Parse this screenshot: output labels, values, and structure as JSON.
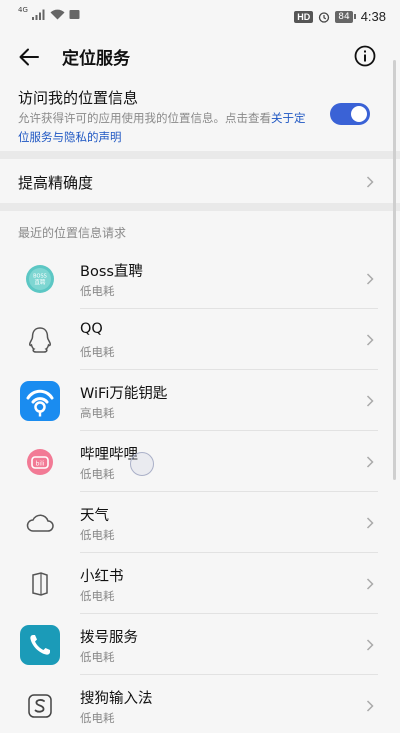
{
  "status_bar": {
    "network": "4G",
    "hd": "HD",
    "battery": "84",
    "time": "4:38"
  },
  "header": {
    "title": "定位服务",
    "back_icon": "back-arrow-icon",
    "info_icon": "info-icon"
  },
  "location_access": {
    "title": "访问我的位置信息",
    "desc": "允许获得许可的应用使用我的位置信息。点击查看",
    "link": "关于定位服务与隐私的声明",
    "enabled": true,
    "toggle_color": "#3a62d6"
  },
  "precision": {
    "label": "提高精确度"
  },
  "recent": {
    "header": "最近的位置信息请求",
    "apps": [
      {
        "name": "Boss直聘",
        "usage": "低电耗",
        "icon": "boss-zhipin-icon",
        "icon_text": "Boss直聘"
      },
      {
        "name": "QQ",
        "usage": "低电耗",
        "icon": "qq-penguin-icon"
      },
      {
        "name": "WiFi万能钥匙",
        "usage": "高电耗",
        "icon": "wifi-key-icon"
      },
      {
        "name": "哔哩哔哩",
        "usage": "低电耗",
        "icon": "bilibili-icon",
        "icon_text": "bili"
      },
      {
        "name": "天气",
        "usage": "低电耗",
        "icon": "weather-cloud-icon"
      },
      {
        "name": "小红书",
        "usage": "低电耗",
        "icon": "xiaohongshu-icon"
      },
      {
        "name": "拨号服务",
        "usage": "低电耗",
        "icon": "phone-dialer-icon"
      },
      {
        "name": "搜狗输入法",
        "usage": "低电耗",
        "icon": "sogou-input-icon"
      }
    ]
  }
}
